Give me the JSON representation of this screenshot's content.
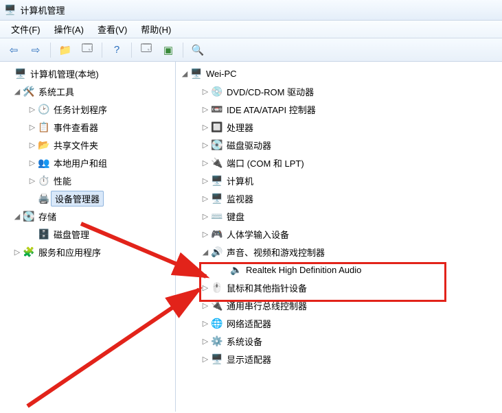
{
  "window": {
    "title": "计算机管理"
  },
  "menu": {
    "file": "文件(F)",
    "action": "操作(A)",
    "view": "查看(V)",
    "help": "帮助(H)"
  },
  "toolbar": {
    "back": "后退",
    "forward": "前进",
    "up": "上级",
    "properties": "属性",
    "help": "帮助",
    "console": "控制台",
    "run": "运行",
    "scan": "扫描"
  },
  "leftTree": {
    "root": "计算机管理(本地)",
    "systemTools": "系统工具",
    "taskScheduler": "任务计划程序",
    "eventViewer": "事件查看器",
    "sharedFolders": "共享文件夹",
    "localUsers": "本地用户和组",
    "performance": "性能",
    "deviceManager": "设备管理器",
    "storage": "存储",
    "diskManagement": "磁盘管理",
    "services": "服务和应用程序"
  },
  "rightTree": {
    "root": "Wei-PC",
    "dvd": "DVD/CD-ROM 驱动器",
    "ide": "IDE ATA/ATAPI 控制器",
    "processors": "处理器",
    "diskDrives": "磁盘驱动器",
    "ports": "端口 (COM 和 LPT)",
    "computer": "计算机",
    "monitors": "监视器",
    "keyboards": "键盘",
    "hid": "人体学输入设备",
    "sound": "声音、视频和游戏控制器",
    "realtek": "Realtek High Definition Audio",
    "mouse": "鼠标和其他指针设备",
    "usb": "通用串行总线控制器",
    "network": "网络适配器",
    "system": "系统设备",
    "display": "显示适配器"
  }
}
